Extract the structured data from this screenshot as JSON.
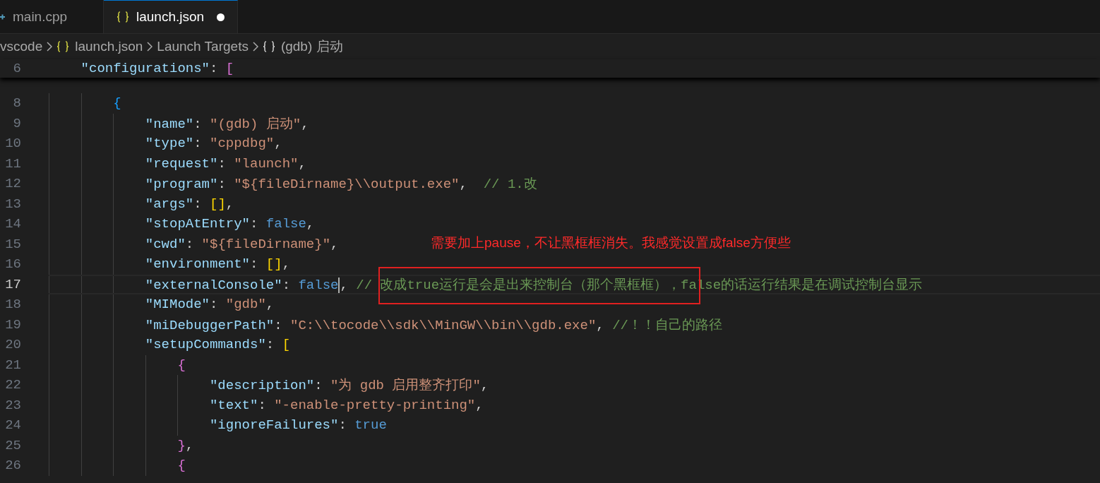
{
  "tabs": [
    {
      "label": "main.cpp",
      "kind": "cpp",
      "selected": false,
      "modified": false
    },
    {
      "label": "launch.json",
      "kind": "json",
      "selected": true,
      "modified": true
    }
  ],
  "breadcrumb": [
    {
      "label": "vscode",
      "kind": "folder"
    },
    {
      "label": "launch.json",
      "kind": "json"
    },
    {
      "label": "Launch Targets",
      "kind": "section"
    },
    {
      "label": "(gdb) 启动",
      "kind": "object"
    }
  ],
  "sticky_line": {
    "number": "6",
    "tokens": [
      {
        "kind": "key",
        "text": "\"configurations\""
      },
      {
        "kind": "punct",
        "text": ": "
      },
      {
        "kind": "bracket",
        "text": "[",
        "color": "#da70d6"
      }
    ]
  },
  "lines": [
    {
      "number": "8",
      "current": false,
      "tokens": [
        {
          "kind": "bracket",
          "text": "{",
          "color": "#179fff"
        }
      ],
      "children": [
        {
          "number": "9",
          "current": false,
          "tokens": [
            {
              "kind": "key",
              "text": "\"name\""
            },
            {
              "kind": "punct",
              "text": ": "
            },
            {
              "kind": "string",
              "text": "\"(gdb) 启动\""
            },
            {
              "kind": "punct",
              "text": ","
            }
          ]
        },
        {
          "number": "10",
          "current": false,
          "tokens": [
            {
              "kind": "key",
              "text": "\"type\""
            },
            {
              "kind": "punct",
              "text": ": "
            },
            {
              "kind": "string",
              "text": "\"cppdbg\""
            },
            {
              "kind": "punct",
              "text": ","
            }
          ]
        },
        {
          "number": "11",
          "current": false,
          "tokens": [
            {
              "kind": "key",
              "text": "\"request\""
            },
            {
              "kind": "punct",
              "text": ": "
            },
            {
              "kind": "string",
              "text": "\"launch\""
            },
            {
              "kind": "punct",
              "text": ","
            }
          ]
        },
        {
          "number": "12",
          "current": false,
          "tokens": [
            {
              "kind": "key",
              "text": "\"program\""
            },
            {
              "kind": "punct",
              "text": ": "
            },
            {
              "kind": "string",
              "text": "\"${fileDirname}\\\\output.exe\""
            },
            {
              "kind": "punct",
              "text": ",  "
            },
            {
              "kind": "comment",
              "text": "// 1.改"
            }
          ]
        },
        {
          "number": "13",
          "current": false,
          "tokens": [
            {
              "kind": "key",
              "text": "\"args\""
            },
            {
              "kind": "punct",
              "text": ": "
            },
            {
              "kind": "bracket",
              "text": "[]",
              "color": "#ffd700"
            },
            {
              "kind": "punct",
              "text": ","
            }
          ]
        },
        {
          "number": "14",
          "current": false,
          "tokens": [
            {
              "kind": "key",
              "text": "\"stopAtEntry\""
            },
            {
              "kind": "punct",
              "text": ": "
            },
            {
              "kind": "keyword",
              "text": "false"
            },
            {
              "kind": "punct",
              "text": ","
            }
          ]
        },
        {
          "number": "15",
          "current": false,
          "tokens": [
            {
              "kind": "key",
              "text": "\"cwd\""
            },
            {
              "kind": "punct",
              "text": ": "
            },
            {
              "kind": "string",
              "text": "\"${fileDirname}\""
            },
            {
              "kind": "punct",
              "text": ","
            }
          ]
        },
        {
          "number": "16",
          "current": false,
          "tokens": [
            {
              "kind": "key",
              "text": "\"environment\""
            },
            {
              "kind": "punct",
              "text": ": "
            },
            {
              "kind": "bracket",
              "text": "[]",
              "color": "#ffd700"
            },
            {
              "kind": "punct",
              "text": ","
            }
          ]
        },
        {
          "number": "17",
          "current": true,
          "tokens": [
            {
              "kind": "key",
              "text": "\"externalConsole\""
            },
            {
              "kind": "punct",
              "text": ": "
            },
            {
              "kind": "keyword",
              "text": "false"
            },
            {
              "kind": "cursor"
            },
            {
              "kind": "punct",
              "text": ", "
            },
            {
              "kind": "comment",
              "text": "// 改成true运行是会是出来控制台（那个黑框框），false的话运行结果是在调试控制台显示"
            }
          ]
        },
        {
          "number": "18",
          "current": false,
          "tokens": [
            {
              "kind": "key",
              "text": "\"MIMode\""
            },
            {
              "kind": "punct",
              "text": ": "
            },
            {
              "kind": "string",
              "text": "\"gdb\""
            },
            {
              "kind": "punct",
              "text": ","
            }
          ]
        },
        {
          "number": "19",
          "current": false,
          "tokens": [
            {
              "kind": "key",
              "text": "\"miDebuggerPath\""
            },
            {
              "kind": "punct",
              "text": ": "
            },
            {
              "kind": "string",
              "text": "\"C:\\\\tocode\\\\sdk\\\\MinGW\\\\bin\\\\gdb.exe\""
            },
            {
              "kind": "punct",
              "text": ", "
            },
            {
              "kind": "comment",
              "text": "//！！自己的路径"
            }
          ]
        },
        {
          "number": "20",
          "current": false,
          "tokens": [
            {
              "kind": "key",
              "text": "\"setupCommands\""
            },
            {
              "kind": "punct",
              "text": ": "
            },
            {
              "kind": "bracket",
              "text": "[",
              "color": "#ffd700"
            }
          ],
          "children": [
            {
              "number": "21",
              "current": false,
              "tokens": [
                {
                  "kind": "bracket",
                  "text": "{",
                  "color": "#da70d6"
                }
              ],
              "children": [
                {
                  "number": "22",
                  "current": false,
                  "tokens": [
                    {
                      "kind": "key",
                      "text": "\"description\""
                    },
                    {
                      "kind": "punct",
                      "text": ": "
                    },
                    {
                      "kind": "string",
                      "text": "\"为 gdb 启用整齐打印\""
                    },
                    {
                      "kind": "punct",
                      "text": ","
                    }
                  ]
                },
                {
                  "number": "23",
                  "current": false,
                  "tokens": [
                    {
                      "kind": "key",
                      "text": "\"text\""
                    },
                    {
                      "kind": "punct",
                      "text": ": "
                    },
                    {
                      "kind": "string",
                      "text": "\"-enable-pretty-printing\""
                    },
                    {
                      "kind": "punct",
                      "text": ","
                    }
                  ]
                },
                {
                  "number": "24",
                  "current": false,
                  "tokens": [
                    {
                      "kind": "key",
                      "text": "\"ignoreFailures\""
                    },
                    {
                      "kind": "punct",
                      "text": ": "
                    },
                    {
                      "kind": "keyword",
                      "text": "true"
                    }
                  ]
                }
              ]
            },
            {
              "number": "25",
              "current": false,
              "tokens": [
                {
                  "kind": "bracket",
                  "text": "}",
                  "color": "#da70d6"
                },
                {
                  "kind": "punct",
                  "text": ","
                }
              ]
            },
            {
              "number": "26",
              "current": false,
              "tokens": [
                {
                  "kind": "bracket",
                  "text": "{",
                  "color": "#da70d6"
                }
              ]
            }
          ]
        }
      ]
    }
  ],
  "annotation": {
    "text": "需要加上pause，不让黑框框消失。我感觉设置成false方便些"
  }
}
